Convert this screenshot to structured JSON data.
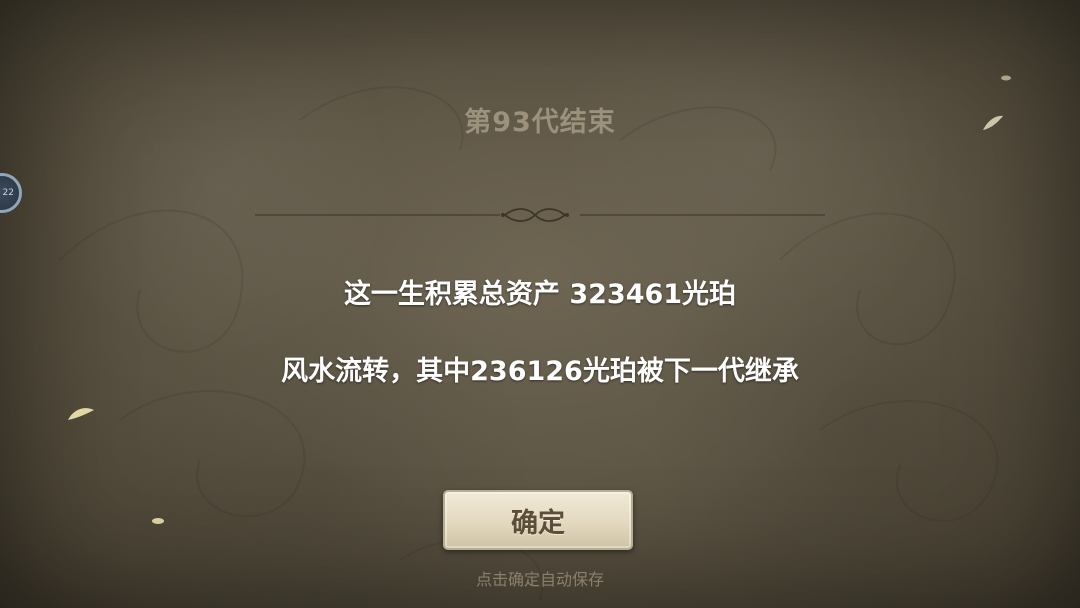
{
  "dialog": {
    "title": "第93代结束",
    "summary_line": "这一生积累总资产 323461光珀",
    "inherit_line": "风水流转，其中236126光珀被下一代继承",
    "confirm_label": "确定",
    "save_hint": "点击确定自动保存"
  },
  "side_badge": {
    "label": "22"
  },
  "colors": {
    "background": "#5f5746",
    "title": "#9b917c",
    "text": "#ffffff",
    "button_face": "#e3d9c0",
    "button_text": "#5c4e38",
    "hint": "#8a806c"
  }
}
